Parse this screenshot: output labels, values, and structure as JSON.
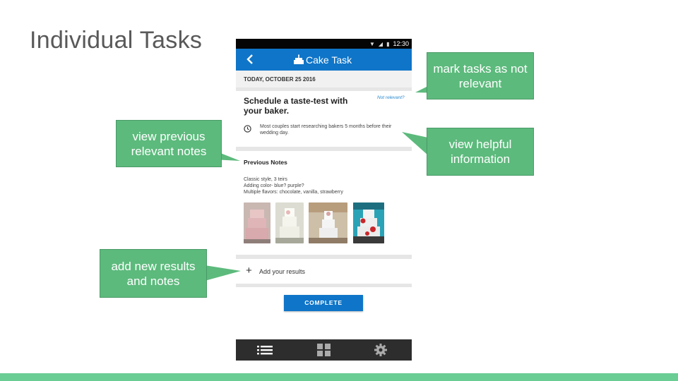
{
  "slide": {
    "title": "Individual Tasks"
  },
  "status_bar": {
    "time": "12:30",
    "icons": [
      "wifi-icon",
      "signal-icon",
      "battery-icon"
    ]
  },
  "app_bar": {
    "title": "Cake Task",
    "back_icon": "back-arrow-icon",
    "title_icon": "cake-icon"
  },
  "date": "TODAY, OCTOBER 25 2016",
  "task": {
    "title": "Schedule a taste-test with your baker.",
    "not_relevant_link": "Not relevant?",
    "tip": "Most couples start researching bakers 5 months before their wedding day."
  },
  "previous_notes": {
    "heading": "Previous Notes",
    "lines": [
      "Classic style, 3 teirs",
      "Adding color- blue? purple?",
      "Multiple flavors: chocolate, vanilla, strawberry"
    ],
    "photos": [
      "pink-cake-photo",
      "white-cake-photo",
      "tiered-cake-photo",
      "red-floral-cake-photo"
    ]
  },
  "add_results": {
    "label": "Add your results"
  },
  "complete_button": "COMPLETE",
  "bottom_nav": [
    "list-icon",
    "grid-icon",
    "settings-gear-icon"
  ],
  "callouts": {
    "mark_tasks": "mark tasks as not relevant",
    "view_notes": "view previous relevant notes",
    "view_info": "view helpful information",
    "add_new": "add new results and notes"
  },
  "colors": {
    "app_bar": "#0f75c8",
    "callout": "#5cba7c",
    "bottom_bar": "#6acd94",
    "nav_bar": "#2d2d2d"
  }
}
